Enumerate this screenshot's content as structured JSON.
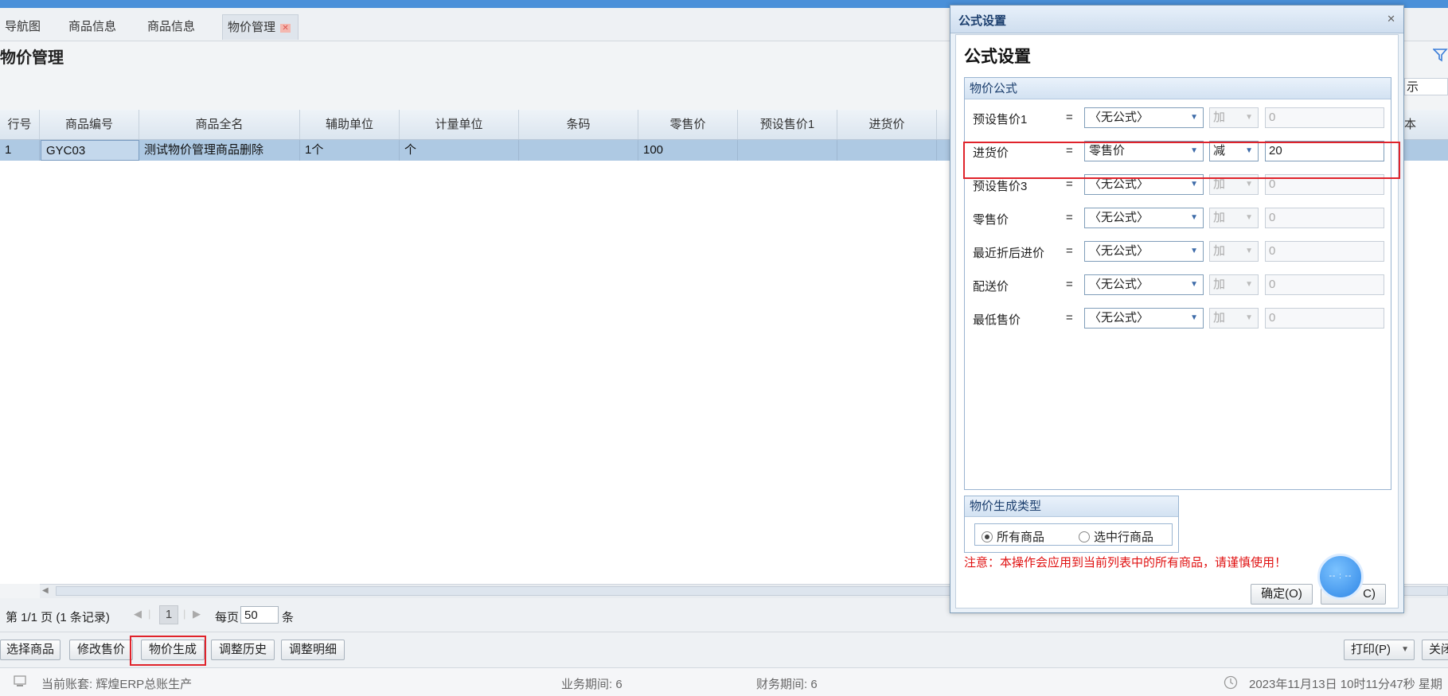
{
  "tabs": [
    {
      "label": "导航图"
    },
    {
      "label": "商品信息"
    },
    {
      "label": "商品信息"
    },
    {
      "label": "物价管理",
      "close": "✕"
    }
  ],
  "page_title": "物价管理",
  "right_partial_label": "示",
  "grid": {
    "columns": [
      "行号",
      "商品编号",
      "商品全名",
      "辅助单位",
      "计量单位",
      "条码",
      "零售价",
      "预设售价1",
      "进货价",
      "本"
    ],
    "rows": [
      {
        "row_no": "1",
        "code": "GYC03",
        "name": "测试物价管理商品删除",
        "aux_unit": "1个",
        "unit": "个",
        "barcode": "",
        "retail": "100",
        "preset1": "",
        "purchase": ""
      }
    ]
  },
  "pager": {
    "info": "第 1/1 页 (1 条记录)",
    "prev": "◀",
    "next": "▶",
    "page": "1",
    "per_page_label": "每页",
    "per_page_value": "50",
    "unit": "条"
  },
  "toolbar": {
    "select_goods": "选择商品",
    "modify_price": "修改售价",
    "generate_price": "物价生成",
    "adjust_history": "调整历史",
    "adjust_detail": "调整明细",
    "print": "打印(P)",
    "close_partial": "关闭"
  },
  "status": {
    "account": "当前账套:   辉煌ERP总账生产",
    "biz_period": "业务期间:   6",
    "fin_period": "财务期间:   6",
    "datetime": "2023年11月13日 10时11分47秒 星期"
  },
  "dialog": {
    "title": "公式设置",
    "heading": "公式设置",
    "close": "✕",
    "formula_legend": "物价公式",
    "formulas": [
      {
        "label": "预设售价1",
        "eq": "=",
        "source": "〈无公式〉",
        "op": "加",
        "value": "0",
        "active": false
      },
      {
        "label": "进货价",
        "eq": "=",
        "source": "零售价",
        "op": "减",
        "value": "20",
        "active": true
      },
      {
        "label": "预设售价3",
        "eq": "=",
        "source": "〈无公式〉",
        "op": "加",
        "value": "0",
        "active": false
      },
      {
        "label": "零售价",
        "eq": "=",
        "source": "〈无公式〉",
        "op": "加",
        "value": "0",
        "active": false
      },
      {
        "label": "最近折后进价",
        "eq": "=",
        "source": "〈无公式〉",
        "op": "加",
        "value": "0",
        "active": false
      },
      {
        "label": "配送价",
        "eq": "=",
        "source": "〈无公式〉",
        "op": "加",
        "value": "0",
        "active": false
      },
      {
        "label": "最低售价",
        "eq": "=",
        "source": "〈无公式〉",
        "op": "加",
        "value": "0",
        "active": false
      }
    ],
    "gen_type_legend": "物价生成类型",
    "gen_options": [
      {
        "label": "所有商品",
        "selected": true
      },
      {
        "label": "选中行商品",
        "selected": false
      }
    ],
    "warning": "注意：本操作会应用到当前列表中的所有商品，请谨慎使用！",
    "ok": "确定(O)",
    "cancel_partial": "C)"
  },
  "float_ball_text": "-- : --",
  "colors": {
    "accent": "#4a90d9",
    "highlight_box": "#e0232b",
    "selected_row": "#aec9e3",
    "warning": "#e01010"
  }
}
